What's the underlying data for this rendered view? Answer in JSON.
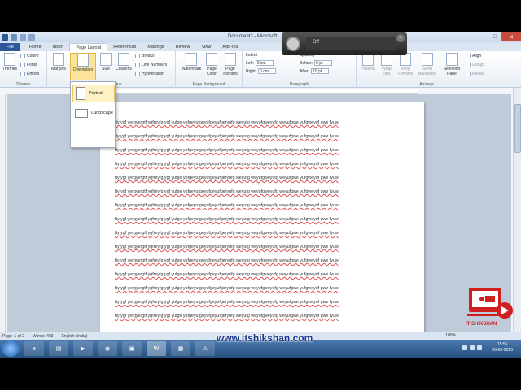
{
  "window": {
    "title": "Document2 - Microsoft"
  },
  "tabs": [
    "File",
    "Home",
    "Insert",
    "Page Layout",
    "References",
    "Mailings",
    "Review",
    "View",
    "Add-Ins"
  ],
  "ribbon": {
    "themes": {
      "label": "Themes",
      "group": "Themes",
      "colors": "Colors",
      "fonts": "Fonts",
      "effects": "Effects"
    },
    "page_setup": {
      "margins": "Margins",
      "orientation": "Orientation",
      "size": "Size",
      "columns": "Columns",
      "breaks": "Breaks",
      "line_numbers": "Line Numbers",
      "hyphenation": "Hyphenation",
      "group": "Page Setup"
    },
    "page_background": {
      "watermark": "Watermark",
      "page_color": "Page Color",
      "page_borders": "Page Borders",
      "group": "Page Background"
    },
    "paragraph": {
      "indent": "Indent",
      "spacing": "Spacing",
      "left_label": "Left:",
      "left_value": "0 cm",
      "right_label": "Right:",
      "right_value": "0 cm",
      "before_label": "Before:",
      "before_value": "0 pt",
      "after_label": "After:",
      "after_value": "10 pt",
      "group": "Paragraph"
    },
    "arrange": {
      "position": "Position",
      "wrap": "Wrap Text",
      "bring": "Bring Forward",
      "send": "Send Backward",
      "selection": "Selection Pane",
      "align": "Align",
      "group_btn": "Group",
      "rotate": "Rotate",
      "group": "Arrange"
    }
  },
  "orientation_menu": {
    "portrait": "Portrait",
    "landscape": "Landscape"
  },
  "speaker": {
    "state": "Off"
  },
  "document": {
    "line": "fty ygf yergyergtf  ygfreyfg ygf yufge yufgeyufgeyufgeyufgeryufg weyufg weyufgweyufg weyufgwe yufgweyuf gwe fyuw",
    "line_count": 15
  },
  "status": {
    "page": "Page: 1 of 2",
    "words": "Words: 403",
    "language": "English (India)",
    "zoom": "100%"
  },
  "taskbar": {
    "website": "www.itshikshan.com",
    "time": "15:55",
    "date": "05-09-2015"
  },
  "logo": {
    "text": "IT SHIKSHAN"
  },
  "colors": {
    "file_tab": "#2b579a",
    "ribbon_hl": "#fbe39a",
    "taskbar": "#25507f",
    "logo": "#d01f1f"
  }
}
